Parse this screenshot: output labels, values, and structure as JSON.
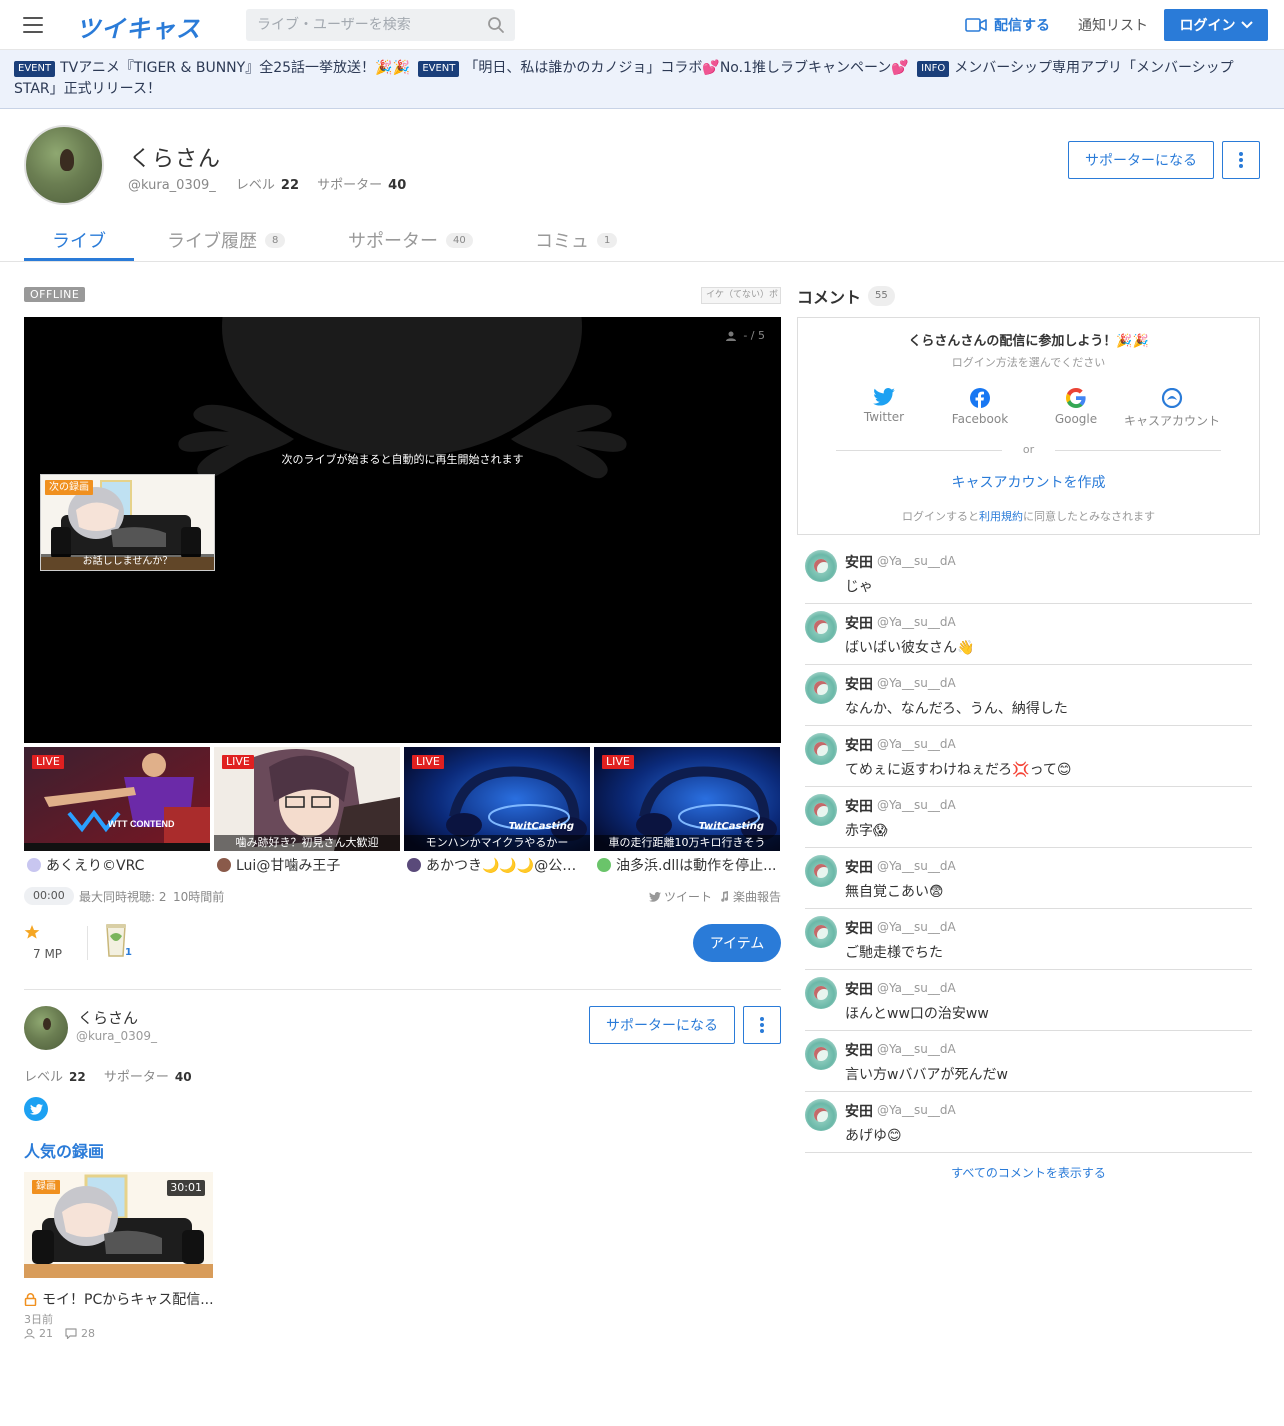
{
  "header": {
    "logo": "ツイキャス",
    "search_placeholder": "ライブ・ユーザーを検索",
    "broadcast_label": "配信する",
    "notify_label": "通知リスト",
    "login_label": "ログイン"
  },
  "infobar": {
    "items": [
      {
        "badge": "EVENT",
        "text": "TVアニメ『TIGER & BUNNY』全25話一挙放送！🎉🎉"
      },
      {
        "badge": "EVENT",
        "text": "「明日、私は誰かのカノジョ」コラボ💕No.1推しラブキャンペーン💕"
      },
      {
        "badge": "INFO",
        "text": "メンバーシップ専用アプリ「メンバーシップSTAR」正式リリース！"
      }
    ]
  },
  "profile": {
    "name": "くらさん",
    "id": "@kura_0309_",
    "level_label": "レベル",
    "level": "22",
    "supporter_label": "サポーター",
    "supporters": "40",
    "support_button": "サポーターになる"
  },
  "tabs": [
    {
      "label": "ライブ",
      "count": ""
    },
    {
      "label": "ライブ履歴",
      "count": "8"
    },
    {
      "label": "サポーター",
      "count": "40"
    },
    {
      "label": "コミュ",
      "count": "1"
    }
  ],
  "player": {
    "status": "OFFLINE",
    "tag": "イケ（てない）ボ",
    "viewers": "- / 5",
    "message": "次のライブが始まると自動的に再生開始されます",
    "next_label": "次の録画",
    "next_caption": "お話ししませんか？"
  },
  "thumbs": [
    {
      "caption": "",
      "user": "あくえり©VRC"
    },
    {
      "caption": "噛み跡好き？初見さん大歓迎",
      "user": "Lui@甘噛み王子"
    },
    {
      "caption": "モンハンかマイクラやるかー",
      "user": "あかつき🌙🌙🌙@公国軍..."
    },
    {
      "caption": "車の走行距離10万キロ行きそう",
      "user": "油多浜.dllは動作を停止..."
    }
  ],
  "live_label": "LIVE",
  "thumb_brand": "TwitCasting",
  "thumb_brand_wtt": "WTT CONTEND",
  "meta": {
    "time": "00:00",
    "max_viewers": "最大同時視聴: 2",
    "ago": "10時間前",
    "tweet": "ツイート",
    "song": "楽曲報告"
  },
  "mp": {
    "value": "7 MP",
    "cup_count": "1"
  },
  "item_button": "アイテム",
  "popular": {
    "title": "人気の録画",
    "label": "録画",
    "duration": "30:01",
    "video_title": "モイ！PCからキャス配信...",
    "ago": "3日前",
    "views": "21",
    "comments": "28"
  },
  "comment_panel": {
    "title": "コメント",
    "count": "55",
    "login_title": "くらさんさんの配信に参加しよう！🎉🎉",
    "login_sub": "ログイン方法を選んでください",
    "services": [
      "Twitter",
      "Facebook",
      "Google",
      "キャスアカウント"
    ],
    "or": "or",
    "create": "キャスアカウントを作成",
    "terms_pre": "ログインすると",
    "terms_link": "利用規約",
    "terms_post": "に同意したとみなされます",
    "show_all": "すべてのコメントを表示する"
  },
  "comments": [
    {
      "name": "安田",
      "id": "@Ya__su__dA",
      "text": "じゃ"
    },
    {
      "name": "安田",
      "id": "@Ya__su__dA",
      "text": "ばいばい彼女さん👋"
    },
    {
      "name": "安田",
      "id": "@Ya__su__dA",
      "text": "なんか、なんだろ、うん、納得した"
    },
    {
      "name": "安田",
      "id": "@Ya__su__dA",
      "text": "てめぇに返すわけねぇだろ💢って😊"
    },
    {
      "name": "安田",
      "id": "@Ya__su__dA",
      "text": "赤字😱"
    },
    {
      "name": "安田",
      "id": "@Ya__su__dA",
      "text": "無自覚こあい😨"
    },
    {
      "name": "安田",
      "id": "@Ya__su__dA",
      "text": "ご馳走様でちた"
    },
    {
      "name": "安田",
      "id": "@Ya__su__dA",
      "text": "ほんとww口の治安ww"
    },
    {
      "name": "安田",
      "id": "@Ya__su__dA",
      "text": "言い方wババアが死んだw"
    },
    {
      "name": "安田",
      "id": "@Ya__su__dA",
      "text": "あげゆ😊"
    }
  ]
}
